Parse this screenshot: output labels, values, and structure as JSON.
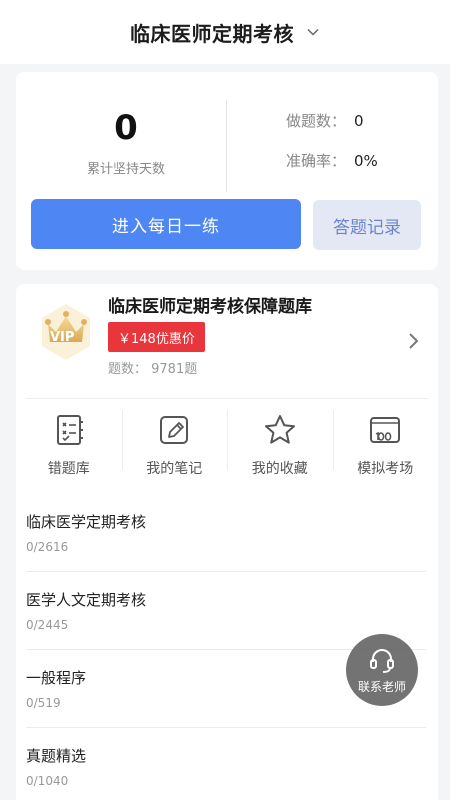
{
  "header": {
    "title": "临床医师定期考核"
  },
  "stats": {
    "days_value": "0",
    "days_label": "累计坚持天数",
    "questions_label": "做题数：",
    "questions_value": "0",
    "accuracy_label": "准确率：",
    "accuracy_value": "0%",
    "practice_button": "进入每日一练",
    "record_button": "答题记录"
  },
  "bank": {
    "badge_text": "VIP",
    "title": "临床医师定期考核保障题库",
    "price_tag": "￥148优惠价",
    "count": "题数：  9781题"
  },
  "tools": [
    {
      "label": "错题库",
      "icon": "wrong-book-icon"
    },
    {
      "label": "我的笔记",
      "icon": "note-icon"
    },
    {
      "label": "我的收藏",
      "icon": "star-icon"
    },
    {
      "label": "模拟考场",
      "icon": "exam-100-icon"
    }
  ],
  "chapters": [
    {
      "name": "临床医学定期考核",
      "progress": "0/2616"
    },
    {
      "name": "医学人文定期考核",
      "progress": "0/2445"
    },
    {
      "name": "一般程序",
      "progress": "0/519"
    },
    {
      "name": "真题精选",
      "progress": "0/1040"
    }
  ],
  "contact": {
    "label": "联系老师",
    "icon": "headset-icon"
  },
  "colors": {
    "primary": "#4e86f4",
    "price_red": "#e8363c",
    "secondary_bg": "#e4e8f5"
  }
}
